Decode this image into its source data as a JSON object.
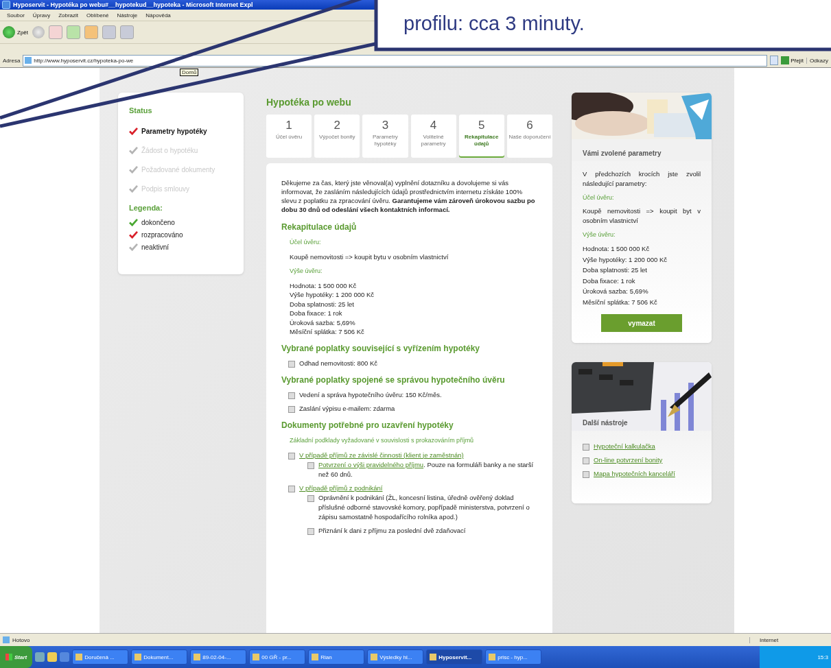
{
  "window": {
    "title": "Hyposervit - Hypotéka po webu#__hypotekud__hypoteka - Microsoft Internet Expl"
  },
  "menu": [
    "Soubor",
    "Úpravy",
    "Zobrazit",
    "Oblíbené",
    "Nástroje",
    "Nápověda"
  ],
  "toolbar": {
    "back": "Zpět"
  },
  "address": {
    "label": "Adresa",
    "url": "http://www.hyposervit.cz/hypoteka-po-we",
    "tooltip": "Domů",
    "go": "Přejít",
    "links": "Odkazy"
  },
  "callout": {
    "text": "profilu: cca 3 minuty."
  },
  "sidebar": {
    "title": "Status",
    "items": [
      {
        "label": "Parametry hypotéky",
        "color": "#d9202a",
        "active": true
      },
      {
        "label": "Žádost o hypotéku",
        "color": "#b4b4b4",
        "active": false
      },
      {
        "label": "Požadované dokumenty",
        "color": "#b4b4b4",
        "active": false
      },
      {
        "label": "Podpis smlouvy",
        "color": "#b4b4b4",
        "active": false
      }
    ],
    "legend_title": "Legenda:",
    "legend": [
      {
        "label": "dokončeno",
        "color": "#4aa832"
      },
      {
        "label": "rozpracováno",
        "color": "#d9202a"
      },
      {
        "label": "neaktivní",
        "color": "#b4b4b4"
      }
    ]
  },
  "page_title": "Hypotéka po webu",
  "steps": [
    {
      "number": "1",
      "label": "Účel úvěru",
      "selected": false
    },
    {
      "number": "2",
      "label": "Výpočet bonity",
      "selected": false
    },
    {
      "number": "3",
      "label": "Parametry hypotéky",
      "selected": false
    },
    {
      "number": "4",
      "label": "Volitelné parametry",
      "selected": false
    },
    {
      "number": "5",
      "label": "Rekapitulace údajů",
      "selected": true
    },
    {
      "number": "6",
      "label": "Naše doporučení",
      "selected": false
    }
  ],
  "content": [
    {
      "kind": "paragraph",
      "text": "Děkujeme za čas, který jste věnoval(a) vyplnění dotazníku a dovolujeme si vás informovat, že zasláním následujících údajů prostřednictvím internetu získáte 100% slevu z poplatku za zpracování úvěru. **Garantujeme vám zároveň úrokovou sazbu po dobu 30 dnů od odeslání všech kontaktních informací.**"
    },
    {
      "kind": "heading",
      "text": "Rekapitulace údajů"
    },
    {
      "kind": "label",
      "text": "Účel úvěru:"
    },
    {
      "kind": "lines",
      "lines": [
        "Koupě nemovitosti => koupit bytu v osobním vlastnictví"
      ]
    },
    {
      "kind": "label",
      "text": "Výše úvěru:"
    },
    {
      "kind": "lines",
      "lines": [
        "Hodnota: 1 500 000 Kč",
        "Výše hypotéky: 1 200 000 Kč",
        "Doba splatnosti: 25 let",
        "Doba fixace: 1 rok",
        "Úroková sazba: 5,69%",
        "Měsíční splátka: 7 506 Kč"
      ]
    },
    {
      "kind": "heading",
      "text": "Vybrané poplatky související s vyřízením hypotéky"
    },
    {
      "kind": "list",
      "items": [
        {
          "text": "Odhad nemovitosti: 800 Kč"
        }
      ]
    },
    {
      "kind": "heading",
      "text": "Vybrané poplatky spojené se správou hypotečního úvěru"
    },
    {
      "kind": "list",
      "items": [
        {
          "text": "Vedení a správa hypotečního úvěru: 150 Kč/měs."
        },
        {
          "text": "Zaslání výpisu e-mailem: zdarma"
        }
      ]
    },
    {
      "kind": "heading",
      "text": "Dokumenty potřebné pro uzavření hypotéky"
    },
    {
      "kind": "label",
      "text": "Základní podklady vyžadované v souvislosti s prokazováním příjmů"
    },
    {
      "kind": "list",
      "items": [
        {
          "link": "V případě příjmů ze závislé činnosti (klient je zaměstnán)",
          "children": [
            {
              "link": "Potvrzení o výši pravidelného příjmu",
              "text": ". Pouze na formuláři banky a ne starší než 60 dnů."
            }
          ]
        },
        {
          "link": "V případě příjmů z podnikání",
          "children": [
            {
              "text": "Oprávnění k podnikání (ŽL, koncesní listina, úředně ověřený doklad příslušné odborné stavovské komory, popřípadě ministerstva, potvrzení o zápisu samostatně hospodařícího rolníka apod.)"
            },
            {
              "text": "Přiznání k dani z příjmu za poslední dvě zdaňovací"
            }
          ]
        }
      ]
    }
  ],
  "params": {
    "title": "Vámi zvolené parametry",
    "intro": "V předchozích krocích jste zvolil následující parametry:",
    "purpose_label": "Účel úvěru:",
    "purpose": "Koupě nemovitosti => koupit byt v osobním vlastnictví",
    "amount_label": "Výše úvěru:",
    "lines": [
      "Hodnota: 1 500 000 Kč",
      "Výše hypotéky: 1 200 000 Kč",
      "Doba splatnosti: 25 let",
      "Doba fixace: 1 rok",
      "Úroková sazba: 5,69%",
      "Měsíční splátka: 7 506 Kč"
    ],
    "button": "vymazat"
  },
  "tools": {
    "title": "Další nástroje",
    "links": [
      "Hypoteční kalkulačka",
      "On-line potvrzení bonity",
      "Mapa hypotečních kanceláří"
    ]
  },
  "status_bar": {
    "text": "Hotovo",
    "zone": "Internet"
  },
  "taskbar": {
    "start": "Start",
    "items": [
      {
        "label": "Doručená ...",
        "selected": false
      },
      {
        "label": "Dokument...",
        "selected": false
      },
      {
        "label": "89-02-04-...",
        "selected": false
      },
      {
        "label": "00 GŘ - pr...",
        "selected": false
      },
      {
        "label": "Rian",
        "selected": false
      },
      {
        "label": "Výsledky hl...",
        "selected": false
      },
      {
        "label": "Hyposervit...",
        "selected": true
      },
      {
        "label": "prisc - hyp...",
        "selected": false
      }
    ],
    "clock": "15:3"
  }
}
